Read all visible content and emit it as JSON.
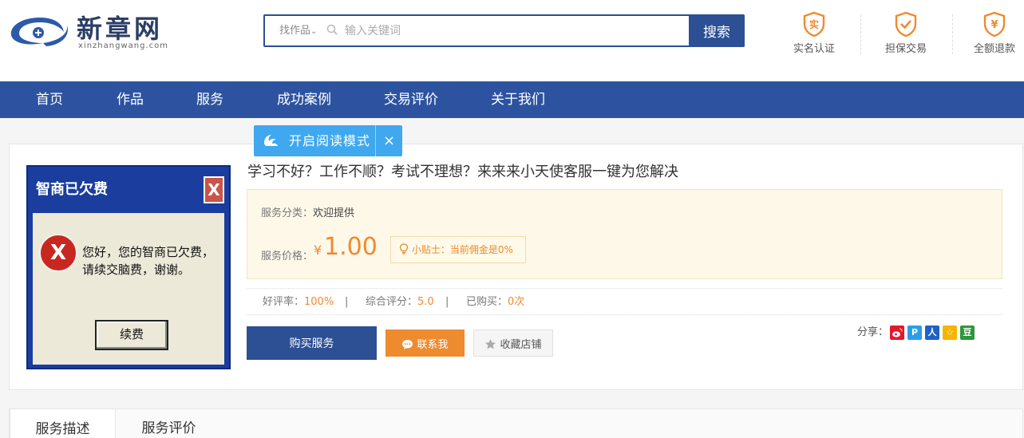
{
  "logo": {
    "name": "新章网",
    "domain": "xinzhangwang.com"
  },
  "search": {
    "category": "找作品",
    "placeholder": "输入关键词",
    "value": "",
    "button": "搜索"
  },
  "badges": [
    {
      "icon": "实",
      "label": "实名认证"
    },
    {
      "icon": "✓",
      "label": "担保交易"
    },
    {
      "icon": "¥",
      "label": "全额退款"
    }
  ],
  "nav": [
    "首页",
    "作品",
    "服务",
    "成功案例",
    "交易评价",
    "关于我们"
  ],
  "reading_mode": {
    "label": "开启阅读模式",
    "close": "×"
  },
  "product": {
    "image": {
      "title": "智商已欠费",
      "close": "X",
      "error": "X",
      "message": "您好，您的智商已欠费，请续交脑费，谢谢。",
      "button": "续费"
    },
    "title": "学习不好？工作不顺？考试不理想？来来来小天使客服一键为您解决",
    "category_label": "服务分类：",
    "category_value": "欢迎提供",
    "price_label": "服务价格：",
    "currency": "¥",
    "price": "1.00",
    "tip": "小贴士：当前佣金是0%",
    "stats": {
      "good_rate_label": "好评率：",
      "good_rate": "100%",
      "sep1": "|",
      "score_label": "综合评分：",
      "score": "5.0",
      "sep2": "|",
      "bought_label": "已购买：",
      "bought": "0次"
    },
    "buy_button": "购买服务",
    "contact_button": "联系我",
    "favorite_button": "收藏店铺",
    "share_label": "分享：",
    "share_icons": [
      "weibo",
      "qzone",
      "renren",
      "qq",
      "douban"
    ],
    "share_glyphs": {
      "qzone": "P",
      "renren": "人",
      "qq": "☆",
      "douban": "豆"
    }
  },
  "tabs": [
    "服务描述",
    "服务评价"
  ],
  "colors": {
    "brand": "#2d53a0",
    "accent": "#f0892f",
    "reading": "#3fa8ee"
  }
}
